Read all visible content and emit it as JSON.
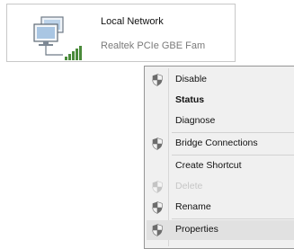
{
  "adapter": {
    "name": "Local Network",
    "device": "Realtek PCIe GBE Fam"
  },
  "menu": {
    "items": [
      {
        "label": "Disable",
        "shield": true,
        "bold": false,
        "disabled": false
      },
      {
        "label": "Status",
        "shield": false,
        "bold": true,
        "disabled": false
      },
      {
        "label": "Diagnose",
        "shield": false,
        "bold": false,
        "disabled": false
      },
      {
        "label": "Bridge Connections",
        "shield": true,
        "bold": false,
        "disabled": false
      },
      {
        "label": "Create Shortcut",
        "shield": false,
        "bold": false,
        "disabled": false
      },
      {
        "label": "Delete",
        "shield": true,
        "bold": false,
        "disabled": true
      },
      {
        "label": "Rename",
        "shield": true,
        "bold": false,
        "disabled": false
      },
      {
        "label": "Properties",
        "shield": true,
        "bold": false,
        "disabled": false,
        "highlighted": true
      }
    ]
  }
}
